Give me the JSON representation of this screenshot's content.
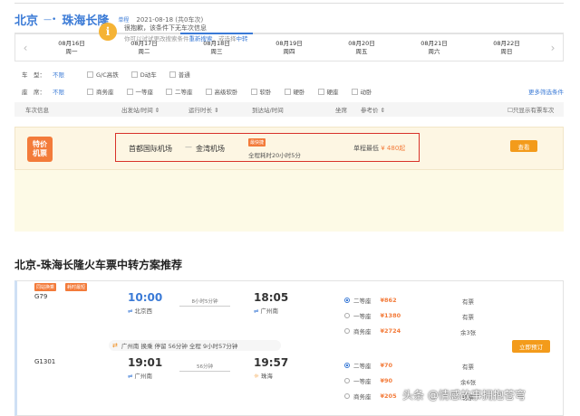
{
  "header": {
    "from": "北京",
    "arrow": "—•",
    "to": "珠海长隆",
    "oneway": "单程",
    "date_info": "2021-08-18 (共0车次)"
  },
  "dates": [
    {
      "date": "08月16日",
      "week": "周一"
    },
    {
      "date": "08月17日",
      "week": "周二"
    },
    {
      "date": "08月18日",
      "week": "周三",
      "active": true
    },
    {
      "date": "08月19日",
      "week": "周四"
    },
    {
      "date": "08月20日",
      "week": "周五"
    },
    {
      "date": "08月21日",
      "week": "周六"
    },
    {
      "date": "08月22日",
      "week": "周日"
    }
  ],
  "filters": {
    "type_label": "车　型：",
    "type_selected": "不限",
    "type_options": [
      "G/C高铁",
      "D动车",
      "普通"
    ],
    "seat_label": "座　席：",
    "seat_selected": "不限",
    "seat_options": [
      "商务座",
      "一等座",
      "二等座",
      "高级软卧",
      "软卧",
      "硬卧",
      "硬座",
      "动卧"
    ],
    "more": "更多筛选条件"
  },
  "columns": [
    "车次信息",
    "出发站/时间 ⇕",
    "运行时长 ⇕",
    "到达站/时间",
    "坐席",
    "参考价 ⇕",
    "☐只显示有票车次"
  ],
  "flight": {
    "badge_line1": "特价",
    "badge_line2": "机票",
    "from": "首都国际机场",
    "dash": "—",
    "to": "金湾机场",
    "tag": "最快捷",
    "duration": "全程耗时20小时5分",
    "price_label": "单程最低",
    "price": "¥ 480起",
    "button": "查看"
  },
  "notice": {
    "icon": "i",
    "line1": "很抱歉，该条件下无车次信息",
    "line2_a": "你可以试试更改搜索条件",
    "line2_link1": "重新搜索",
    "line2_b": "，或选择",
    "line2_link2": "中转"
  },
  "transfer": {
    "title": "北京-珠海长隆火车票中转方案推荐",
    "tags": [
      "同站换乘",
      "耗时最短"
    ],
    "leg1": {
      "train": "G79",
      "dep_time": "10:00",
      "dep_station": "北京西",
      "duration": "8小时5分钟",
      "arr_time": "18:05",
      "arr_station": "广州南",
      "seats": [
        {
          "name": "二等座",
          "price": "¥862",
          "avail": "有票",
          "selected": true
        },
        {
          "name": "一等座",
          "price": "¥1380",
          "avail": "有票"
        },
        {
          "name": "商务座",
          "price": "¥2724",
          "avail": "余3张"
        }
      ]
    },
    "transfer_info": "广州南 换乘 停留 56分钟 全程 9小时57分钟",
    "book_button": "立即预订",
    "leg2": {
      "train": "G1301",
      "dep_time": "19:01",
      "dep_station": "广州南",
      "duration": "56分钟",
      "arr_time": "19:57",
      "arr_station": "珠海",
      "seats": [
        {
          "name": "二等座",
          "price": "¥70",
          "avail": "有票",
          "selected": true
        },
        {
          "name": "一等座",
          "price": "¥90",
          "avail": "余6张"
        },
        {
          "name": "商务座",
          "price": "¥205",
          "avail": "有票"
        }
      ]
    }
  },
  "watermark": "头条 @情感故事拥抱苍穹"
}
